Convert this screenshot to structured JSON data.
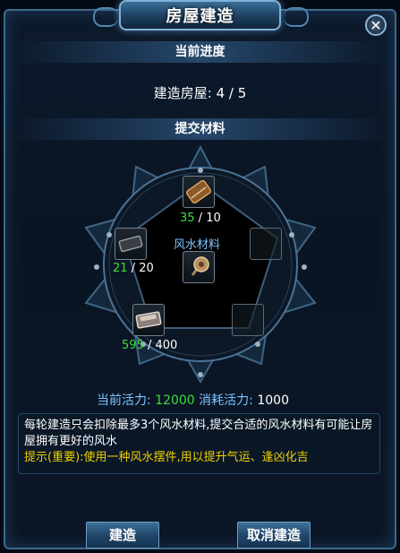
{
  "window": {
    "title": "房屋建造",
    "close_label": "✕"
  },
  "progress": {
    "header": "当前进度",
    "label": "建造房屋:",
    "value": "4 / 5"
  },
  "materials": {
    "header": "提交材料",
    "center_label": "风水材料",
    "slots": [
      {
        "name": "scroll-item",
        "have": "35",
        "need": "10"
      },
      {
        "name": "dark-block-item",
        "have": "21",
        "need": "20"
      },
      {
        "name": "empty-right-upper"
      },
      {
        "name": "silver-ingot-item",
        "have": "595",
        "need": "400"
      },
      {
        "name": "empty-right-lower"
      },
      {
        "name": "fengshui-compass-item"
      }
    ]
  },
  "vitality": {
    "current_label": "当前活力:",
    "current_value": "12000",
    "cost_label": "消耗活力:",
    "cost_value": "1000"
  },
  "description": {
    "text": "每轮建造只会扣除最多3个风水材料,提交合适的风水材料有可能让房屋拥有更好的风水",
    "hint": "提示(重要):使用一种风水摆件,用以提升气运、逢凶化吉"
  },
  "buttons": {
    "build": "建造",
    "cancel": "取消建造"
  },
  "colors": {
    "accent": "#7ec4ff",
    "have": "#3edc3e",
    "hint": "#f0d000",
    "frame": "#3d6a8e"
  }
}
